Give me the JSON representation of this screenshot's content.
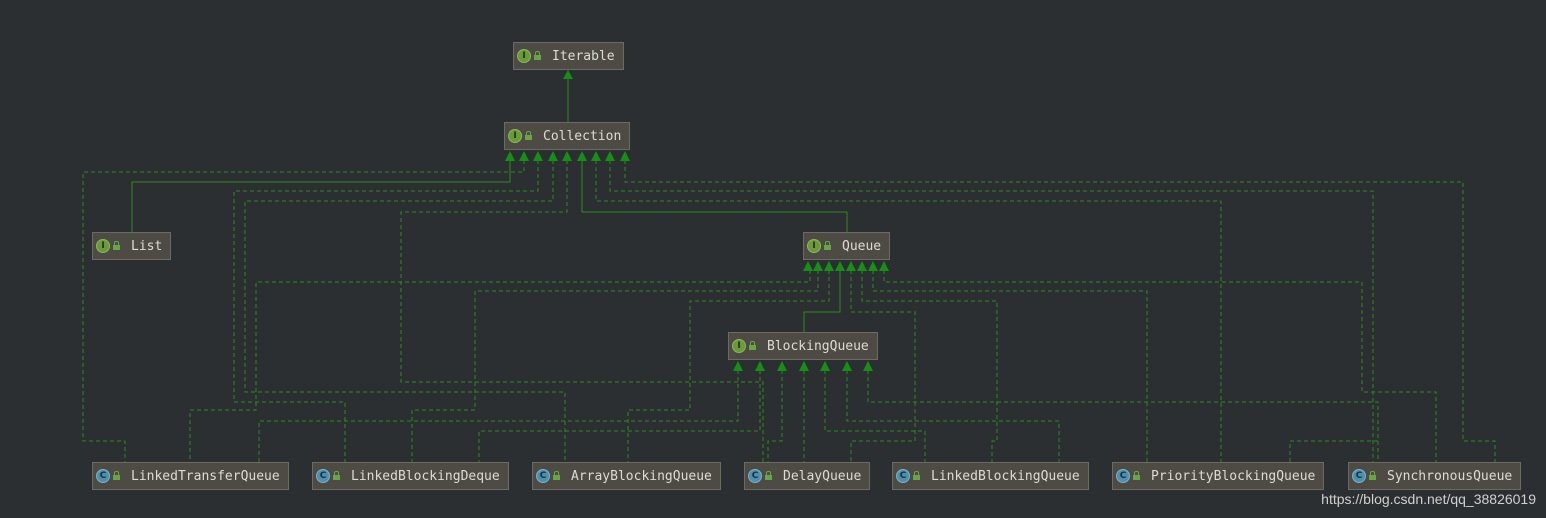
{
  "diagram": {
    "nodes": [
      {
        "id": "iterable",
        "kind": "I",
        "label": "Iterable"
      },
      {
        "id": "collection",
        "kind": "I",
        "label": "Collection"
      },
      {
        "id": "list",
        "kind": "I",
        "label": "List"
      },
      {
        "id": "queue",
        "kind": "I",
        "label": "Queue"
      },
      {
        "id": "blockingqueue",
        "kind": "I",
        "label": "BlockingQueue"
      },
      {
        "id": "linkedtransferqueue",
        "kind": "C",
        "label": "LinkedTransferQueue"
      },
      {
        "id": "linkedblockingdeque",
        "kind": "C",
        "label": "LinkedBlockingDeque"
      },
      {
        "id": "arrayblockingqueue",
        "kind": "C",
        "label": "ArrayBlockingQueue"
      },
      {
        "id": "delayqueue",
        "kind": "C",
        "label": "DelayQueue"
      },
      {
        "id": "linkedblockingqueue",
        "kind": "C",
        "label": "LinkedBlockingQueue"
      },
      {
        "id": "priorityblockingqueue",
        "kind": "C",
        "label": "PriorityBlockingQueue"
      },
      {
        "id": "synchronousqueue",
        "kind": "C",
        "label": "SynchronousQueue"
      }
    ]
  },
  "colors": {
    "edge": "#2e8b20",
    "arrow": "#159015",
    "interface_badge": "#6a9a3a",
    "class_badge": "#4f8fad"
  },
  "watermark": "https://blog.csdn.net/qq_38826019"
}
